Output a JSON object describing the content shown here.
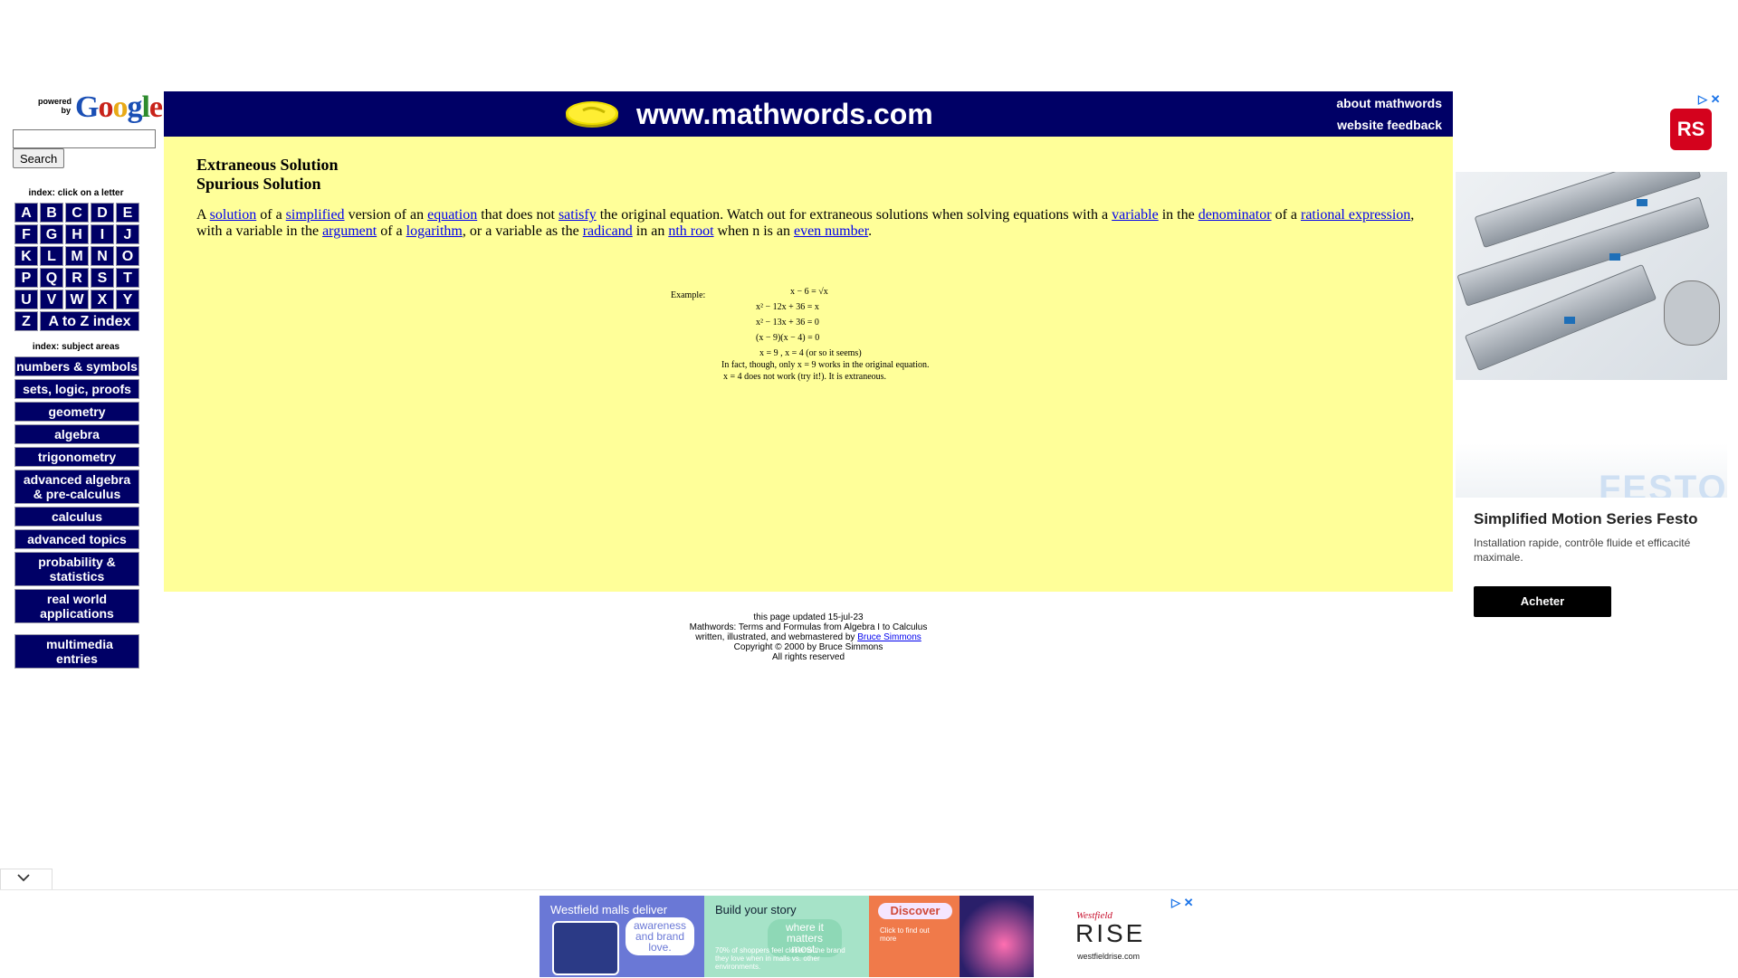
{
  "sidebar": {
    "powered_by": "powered by",
    "google_brand": "Google",
    "search_value": "",
    "search_button": "Search",
    "letters_caption": "index: click on a letter",
    "letters": [
      "A",
      "B",
      "C",
      "D",
      "E",
      "F",
      "G",
      "H",
      "I",
      "J",
      "K",
      "L",
      "M",
      "N",
      "O",
      "P",
      "Q",
      "R",
      "S",
      "T",
      "U",
      "V",
      "W",
      "X",
      "Y",
      "Z"
    ],
    "az_index": "A to Z index",
    "subjects_caption": "index: subject areas",
    "subjects": [
      "numbers & symbols",
      "sets, logic, proofs",
      "geometry",
      "algebra",
      "trigonometry",
      "advanced algebra & pre-calculus",
      "calculus",
      "advanced topics",
      "probability & statistics",
      "real world applications"
    ],
    "multimedia": "multimedia entries"
  },
  "header": {
    "site_title": "www.mathwords.com",
    "about_link": "about mathwords",
    "feedback_link": "website feedback",
    "bg_color": "#000066"
  },
  "content": {
    "title1": "Extraneous Solution",
    "title2": "Spurious Solution",
    "definition": [
      {
        "t": "A "
      },
      {
        "t": "solution",
        "link": true
      },
      {
        "t": " of a "
      },
      {
        "t": "simplified",
        "link": true
      },
      {
        "t": " version of an "
      },
      {
        "t": "equation",
        "link": true
      },
      {
        "t": " that does not "
      },
      {
        "t": "satisfy",
        "link": true
      },
      {
        "t": " the original equation. Watch out for extraneous solutions when solving equations with a "
      },
      {
        "t": "variable",
        "link": true
      },
      {
        "t": " in the "
      },
      {
        "t": "denominator",
        "link": true
      },
      {
        "t": " of a "
      },
      {
        "t": "rational expression",
        "link": true
      },
      {
        "t": ", with a variable in the "
      },
      {
        "t": "argument",
        "link": true
      },
      {
        "t": " of a "
      },
      {
        "t": "logarithm",
        "link": true
      },
      {
        "t": ", or a variable as the "
      },
      {
        "t": "radicand",
        "link": true
      },
      {
        "t": " in an "
      },
      {
        "t": "nth root",
        "link": true
      },
      {
        "t": " when n is an "
      },
      {
        "t": "even number",
        "link": true
      },
      {
        "t": "."
      }
    ],
    "example": {
      "label": "Example:",
      "lines": [
        "x − 6 = √x",
        "x² − 12x + 36 = x",
        "x² − 13x + 36 = 0",
        "(x − 9)(x − 4) = 0",
        "x = 9 , x = 4  (or so it seems)",
        "In fact, though, only x = 9 works in the original equation.",
        "x = 4 does not work (try it!).  It is extraneous."
      ]
    },
    "bg_color": "#ffff99"
  },
  "footer": {
    "updated": "this page updated 15-jul-23",
    "tagline": "Mathwords: Terms and Formulas from Algebra I to Calculus",
    "written_prefix": "written, illustrated, and webmastered by ",
    "author_link": "Bruce Simmons",
    "copyright": "Copyright © 2000 by Bruce Simmons",
    "rights": "All rights reserved"
  },
  "right_ad": {
    "choices_icon": "adchoices-icon",
    "brand_badge": "RS",
    "festo_word": "FESTO",
    "headline": "Simplified Motion Series Festo",
    "subtext": "Installation rapide, contrôle fluide et efficacité maximale.",
    "button": "Acheter"
  },
  "bottom_ad": {
    "tile1_text": "Westfield malls deliver",
    "tile1_pill": "awareness and brand love.",
    "tile2_text": "Build your story",
    "tile2_pill": "where it matters most.",
    "tile2_small": "70% of shoppers feel closer to the brand they love when in malls vs. other environments.",
    "tile3_pill": "Discover",
    "tile3_small": "Click to find out more",
    "tile4_brand": "Westfield",
    "tile4_word": "RISE",
    "tile4_url": "westfieldrise.com"
  }
}
